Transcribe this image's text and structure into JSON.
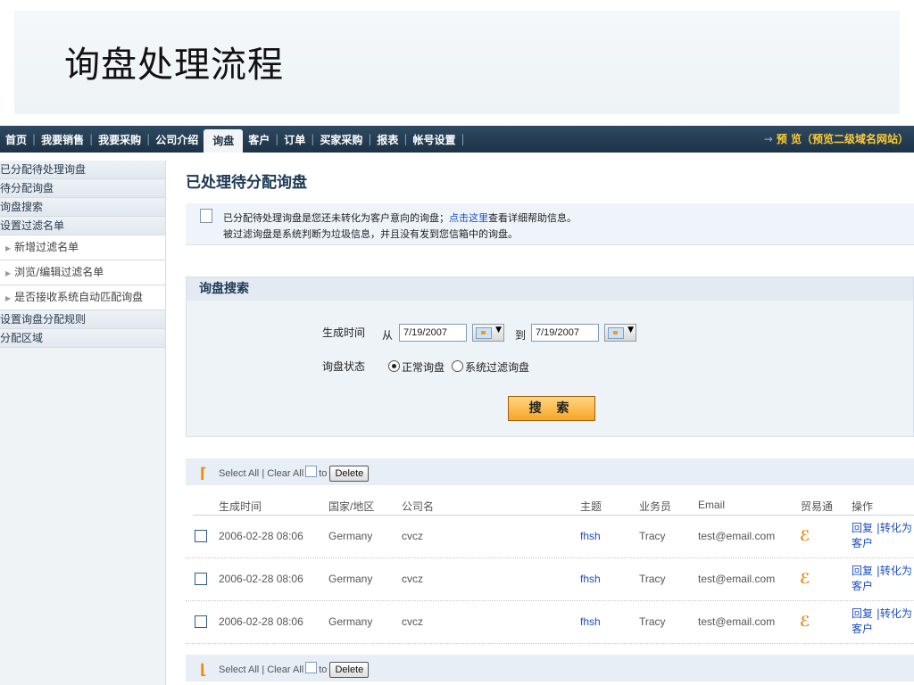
{
  "slide": {
    "title": "询盘处理流程"
  },
  "nav": {
    "items": [
      "首页",
      "我要销售",
      "我要采购",
      "公司介绍",
      "询盘",
      "客户",
      "订单",
      "买家采购",
      "报表",
      "帐号设置"
    ],
    "active": "询盘",
    "preview": "预 览（预览二级域名网站）"
  },
  "sidebar": {
    "items": [
      "已分配待处理询盘",
      "待分配询盘",
      "询盘搜索",
      "设置过滤名单"
    ],
    "subitems": [
      "新增过滤名单",
      "浏览/编辑过滤名单",
      "是否接收系统自动匹配询盘"
    ],
    "items_after": [
      "设置询盘分配规则",
      "分配区域"
    ]
  },
  "main": {
    "title": "已处理待分配询盘",
    "info": {
      "line1_before": "已分配待处理询盘是您还未转化为客户意向的询盘；",
      "line1_link": "点击这里",
      "line1_after": "查看详细帮助信息。",
      "line2": "被过滤询盘是系统判断为垃圾信息，并且没有发到您信箱中的询盘。"
    },
    "search": {
      "heading": "询盘搜索",
      "time_label": "生成时间",
      "from_label": "从",
      "from_value": "7/19/2007",
      "to_label": "到",
      "to_value": "7/19/2007",
      "status_label": "询盘状态",
      "status_options": [
        "正常询盘",
        "系统过滤询盘"
      ],
      "status_selected": "正常询盘",
      "button": "搜 索"
    },
    "list_controls": {
      "select_all": "Select All",
      "separator": "|",
      "clear_all": "Clear All",
      "to": "to",
      "delete": "Delete"
    },
    "table": {
      "headers": [
        "生成时间",
        "国家/地区",
        "公司名",
        "主题",
        "业务员",
        "Email",
        "贸易通",
        "操作"
      ],
      "rows": [
        {
          "time": "2006-02-28 08:06",
          "country": "Germany",
          "company": "cvcz",
          "subject": "fhsh",
          "agent": "Tracy",
          "email": "test@email.com",
          "ops": "回复 |转化为客户"
        },
        {
          "time": "2006-02-28 08:06",
          "country": "Germany",
          "company": "cvcz",
          "subject": "fhsh",
          "agent": "Tracy",
          "email": "test@email.com",
          "ops": "回复 |转化为客户"
        },
        {
          "time": "2006-02-28 08:06",
          "country": "Germany",
          "company": "cvcz",
          "subject": "fhsh",
          "agent": "Tracy",
          "email": "test@email.com",
          "ops": "回复 |转化为客户"
        }
      ]
    }
  }
}
